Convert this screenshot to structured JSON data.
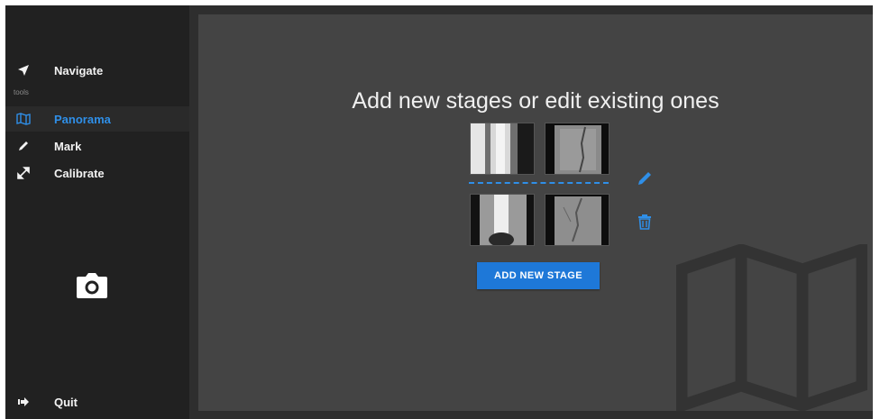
{
  "sidebar": {
    "nav": {
      "label": "Navigate",
      "icon": "navigate-arrow-icon"
    },
    "section_label": "tools",
    "items": [
      {
        "label": "Panorama",
        "icon": "map-icon",
        "active": true
      },
      {
        "label": "Mark",
        "icon": "pencil-icon",
        "active": false
      },
      {
        "label": "Calibrate",
        "icon": "resize-arrows-icon",
        "active": false
      }
    ],
    "camera_icon": "camera-icon",
    "quit": {
      "label": "Quit",
      "icon": "exit-icon"
    }
  },
  "main": {
    "title": "Add new stages or edit existing ones",
    "stages": [
      {
        "thumbnails": [
          "xray-thumbnail",
          "xray-thumbnail"
        ]
      },
      {
        "thumbnails": [
          "xray-thumbnail",
          "xray-thumbnail"
        ]
      }
    ],
    "edit_icon": "pencil-icon",
    "delete_icon": "trash-icon",
    "add_button_label": "ADD NEW STAGE",
    "watermark_icon": "map-icon"
  },
  "colors": {
    "accent": "#2f8fe8",
    "button": "#1e78d8",
    "sidebar_bg": "#212121",
    "main_bg": "#444444"
  }
}
